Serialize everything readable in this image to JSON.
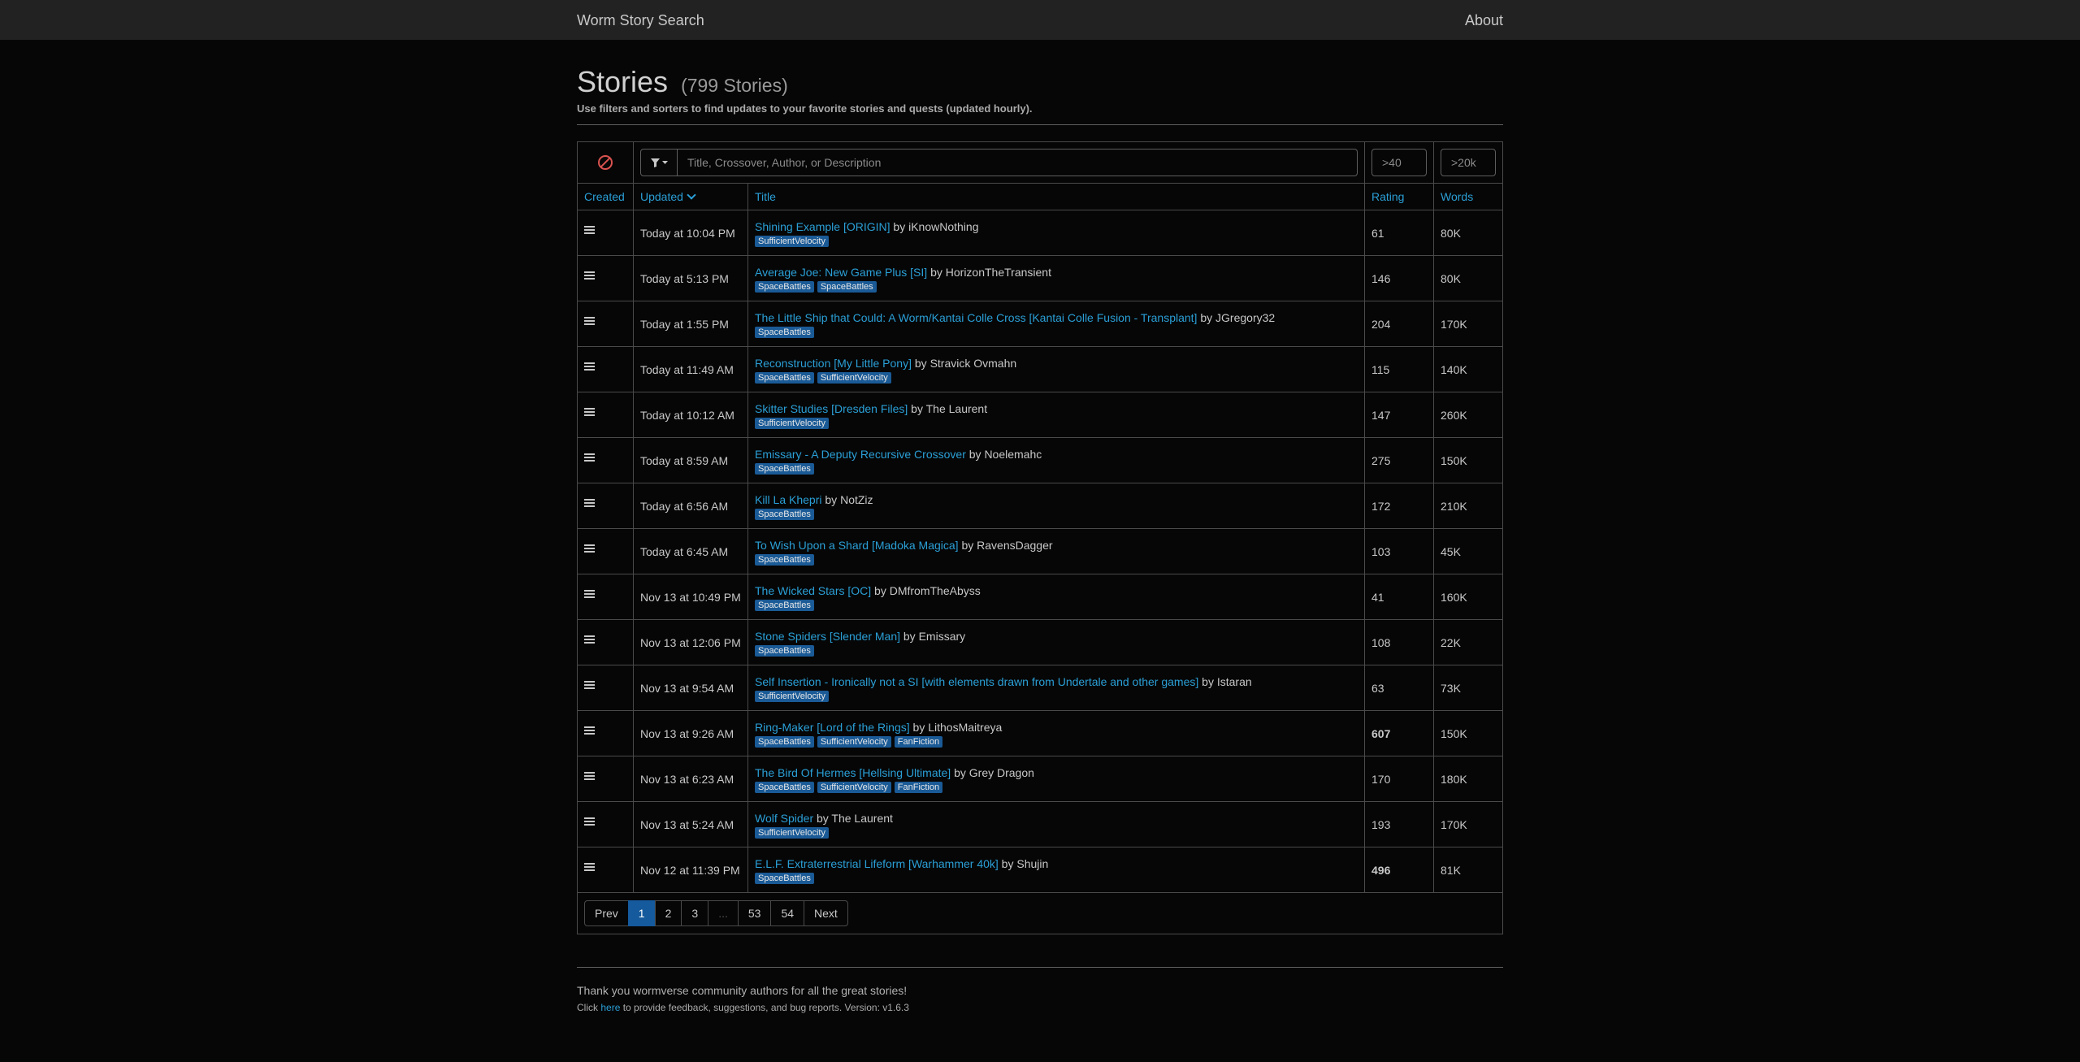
{
  "navbar": {
    "brand": "Worm Story Search",
    "about": "About"
  },
  "header": {
    "title": "Stories",
    "count": "(799 Stories)",
    "subtitle": "Use filters and sorters to find updates to your favorite stories and quests (updated hourly)."
  },
  "filters": {
    "search_placeholder": "Title, Crossover, Author, or Description",
    "rating_placeholder": ">40",
    "words_placeholder": ">20k"
  },
  "columns": {
    "created": "Created",
    "updated": "Updated",
    "title": "Title",
    "rating": "Rating",
    "words": "Words"
  },
  "stories": [
    {
      "updated": "Today at 10:04 PM",
      "title": "Shining Example [ORIGIN]",
      "author": "iKnowNothing",
      "tags": [
        "SufficientVelocity"
      ],
      "rating": "61",
      "words": "80K"
    },
    {
      "updated": "Today at 5:13 PM",
      "title": "Average Joe: New Game Plus [SI]",
      "author": "HorizonTheTransient",
      "tags": [
        "SpaceBattles",
        "SpaceBattles"
      ],
      "rating": "146",
      "words": "80K"
    },
    {
      "updated": "Today at 1:55 PM",
      "title": "The Little Ship that Could: A Worm/Kantai Colle Cross [Kantai Colle Fusion - Transplant]",
      "author": "JGregory32",
      "tags": [
        "SpaceBattles"
      ],
      "rating": "204",
      "words": "170K"
    },
    {
      "updated": "Today at 11:49 AM",
      "title": "Reconstruction [My Little Pony]",
      "author": "Stravick Ovmahn",
      "tags": [
        "SpaceBattles",
        "SufficientVelocity"
      ],
      "rating": "115",
      "words": "140K"
    },
    {
      "updated": "Today at 10:12 AM",
      "title": "Skitter Studies [Dresden Files]",
      "author": "The Laurent",
      "tags": [
        "SufficientVelocity"
      ],
      "rating": "147",
      "words": "260K"
    },
    {
      "updated": "Today at 8:59 AM",
      "title": "Emissary - A Deputy Recursive Crossover",
      "author": "Noelemahc",
      "tags": [
        "SpaceBattles"
      ],
      "rating": "275",
      "words": "150K"
    },
    {
      "updated": "Today at 6:56 AM",
      "title": "Kill La Khepri",
      "author": "NotZiz",
      "tags": [
        "SpaceBattles"
      ],
      "rating": "172",
      "words": "210K"
    },
    {
      "updated": "Today at 6:45 AM",
      "title": "To Wish Upon a Shard [Madoka Magica]",
      "author": "RavensDagger",
      "tags": [
        "SpaceBattles"
      ],
      "rating": "103",
      "words": "45K"
    },
    {
      "updated": "Nov 13 at 10:49 PM",
      "title": "The Wicked Stars [OC]",
      "author": "DMfromTheAbyss",
      "tags": [
        "SpaceBattles"
      ],
      "rating": "41",
      "words": "160K"
    },
    {
      "updated": "Nov 13 at 12:06 PM",
      "title": "Stone Spiders [Slender Man]",
      "author": "Emissary",
      "tags": [
        "SpaceBattles"
      ],
      "rating": "108",
      "words": "22K"
    },
    {
      "updated": "Nov 13 at 9:54 AM",
      "title": "Self Insertion - Ironically not a SI [with elements drawn from Undertale and other games]",
      "author": "Istaran",
      "tags": [
        "SufficientVelocity"
      ],
      "rating": "63",
      "words": "73K"
    },
    {
      "updated": "Nov 13 at 9:26 AM",
      "title": "Ring-Maker [Lord of the Rings]",
      "author": "LithosMaitreya",
      "tags": [
        "SpaceBattles",
        "SufficientVelocity",
        "FanFiction"
      ],
      "rating": "607",
      "words": "150K",
      "bold": true
    },
    {
      "updated": "Nov 13 at 6:23 AM",
      "title": "The Bird Of Hermes [Hellsing Ultimate]",
      "author": "Grey Dragon",
      "tags": [
        "SpaceBattles",
        "SufficientVelocity",
        "FanFiction"
      ],
      "rating": "170",
      "words": "180K"
    },
    {
      "updated": "Nov 13 at 5:24 AM",
      "title": "Wolf Spider",
      "author": "The Laurent",
      "tags": [
        "SufficientVelocity"
      ],
      "rating": "193",
      "words": "170K"
    },
    {
      "updated": "Nov 12 at 11:39 PM",
      "title": "E.L.F. Extraterrestrial Lifeform [Warhammer 40k]",
      "author": "Shujin",
      "tags": [
        "SpaceBattles"
      ],
      "rating": "496",
      "words": "81K",
      "bold": true
    }
  ],
  "pagination": {
    "prev": "Prev",
    "pages": [
      "1",
      "2",
      "3",
      "...",
      "53",
      "54"
    ],
    "active": "1",
    "next": "Next"
  },
  "footer": {
    "thanks": "Thank you wormverse community authors for all the great stories!",
    "click": "Click",
    "here": "here",
    "rest": "to provide feedback, suggestions, and bug reports. Version: v1.6.3"
  },
  "colors": {
    "link": "#2a9fd6",
    "tag_bg": "#1a5a96",
    "active_page": "#155a9c",
    "clear_icon": "#d9534f"
  },
  "icons": {
    "clear": "ban-icon",
    "filter": "filter-icon",
    "row": "list-icon",
    "sort": "chevron-down-icon"
  }
}
